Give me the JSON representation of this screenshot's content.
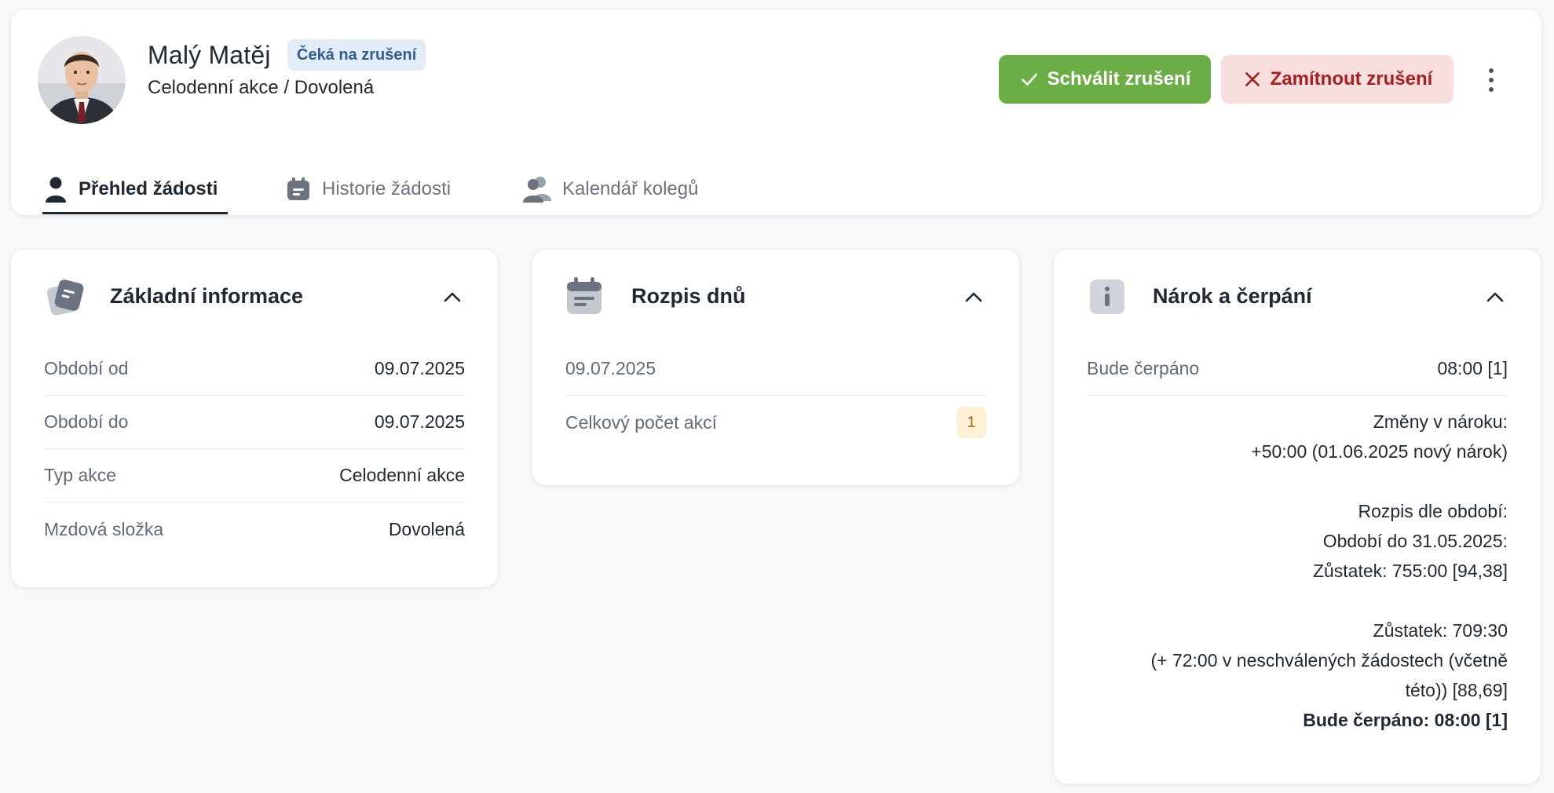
{
  "header": {
    "name": "Malý Matěj",
    "status_badge": "Čeká na zrušení",
    "subtitle": "Celodenní akce / Dovolená",
    "approve_label": "Schválit zrušení",
    "reject_label": "Zamítnout zrušení"
  },
  "tabs": [
    {
      "label": "Přehled žádosti",
      "icon": "person-icon",
      "active": true
    },
    {
      "label": "Historie žádosti",
      "icon": "calendar-icon",
      "active": false
    },
    {
      "label": "Kalendář kolegů",
      "icon": "people-icon",
      "active": false
    }
  ],
  "basic_info": {
    "title": "Základní informace",
    "rows": [
      {
        "label": "Období od",
        "value": "09.07.2025"
      },
      {
        "label": "Období do",
        "value": "09.07.2025"
      },
      {
        "label": "Typ akce",
        "value": "Celodenní akce"
      },
      {
        "label": "Mzdová složka",
        "value": "Dovolená"
      }
    ]
  },
  "days": {
    "title": "Rozpis dnů",
    "date": "09.07.2025",
    "total_label": "Celkový počet akcí",
    "total_value": "1"
  },
  "entitlement": {
    "title": "Nárok a čerpání",
    "row_label": "Bude čerpáno",
    "row_value": "08:00 [1]",
    "changes_heading": "Změny v nároku:",
    "changes_line": "+50:00 (01.06.2025 nový nárok)",
    "period_heading": "Rozpis dle období:",
    "period_line": "Období do 31.05.2025:",
    "period_balance": "Zůstatek: 755:00 [94,38]",
    "balance": "Zůstatek: 709:30",
    "pending_line1": "(+ 72:00 v neschválených žádostech (včetně",
    "pending_line2": "této)) [88,69]",
    "will_draw": "Bude čerpáno: 08:00 [1]"
  },
  "colors": {
    "approve": "#6aae45",
    "reject_bg": "#f8dedd",
    "reject_text": "#a81f1f",
    "badge_bg": "#e3edf8",
    "badge_text": "#2f5f92"
  }
}
